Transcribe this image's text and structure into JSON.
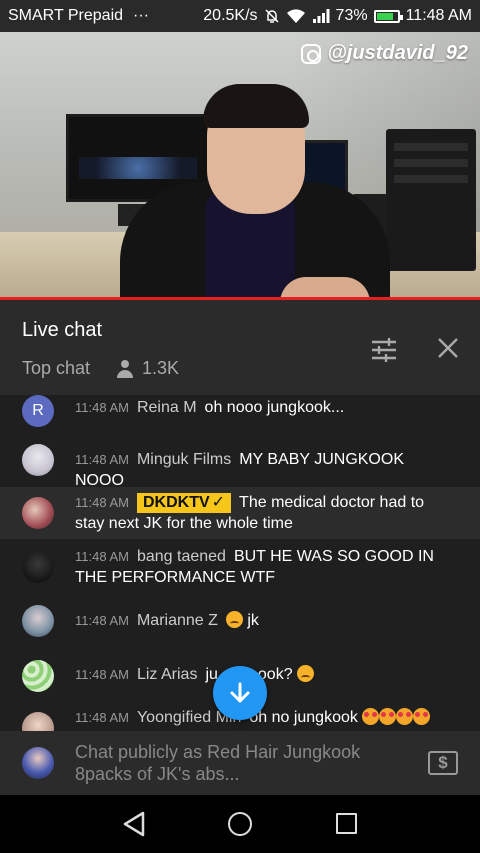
{
  "status_bar": {
    "carrier": "SMART Prepaid",
    "more": "···",
    "net_speed": "20.5K/s",
    "battery": "73%",
    "time": "11:48 AM"
  },
  "video": {
    "watermark": "@justdavid_92",
    "progress": 1.0
  },
  "chat_header": {
    "title": "Live chat",
    "mode": "Top chat",
    "viewers": "1.3K"
  },
  "messages": [
    {
      "avatar_letter": "R",
      "time": "11:48 AM",
      "author": "Reina M",
      "text": "oh nooo jungkook..."
    },
    {
      "time": "11:48 AM",
      "author": "Minguk Films",
      "text": "MY BABY JUNGKOOK NOOO"
    },
    {
      "time": "11:48 AM",
      "badge": "DKDKTV",
      "text": "The medical doctor had to stay next JK for the whole time"
    },
    {
      "time": "11:48 AM",
      "author": "bang taened",
      "text": "BUT HE WAS SO GOOD IN THE PERFORMANCE WTF"
    },
    {
      "time": "11:48 AM",
      "author": "Marianne Z",
      "text": "jk"
    },
    {
      "time": "11:48 AM",
      "author": "Liz Arias",
      "text_before": "ju",
      "text_after": "ook?"
    },
    {
      "time": "11:48 AM",
      "author": "Yoongified Min",
      "text": "oh no jungkook"
    }
  ],
  "composer": {
    "placeholder": "Chat publicly as Red Hair Jungkook 8packs of JK's abs...",
    "currency_symbol": "$"
  },
  "colors": {
    "badge_yellow": "#f7c61b",
    "fab_blue": "#2196f3",
    "progress_red": "#e61f1f"
  }
}
